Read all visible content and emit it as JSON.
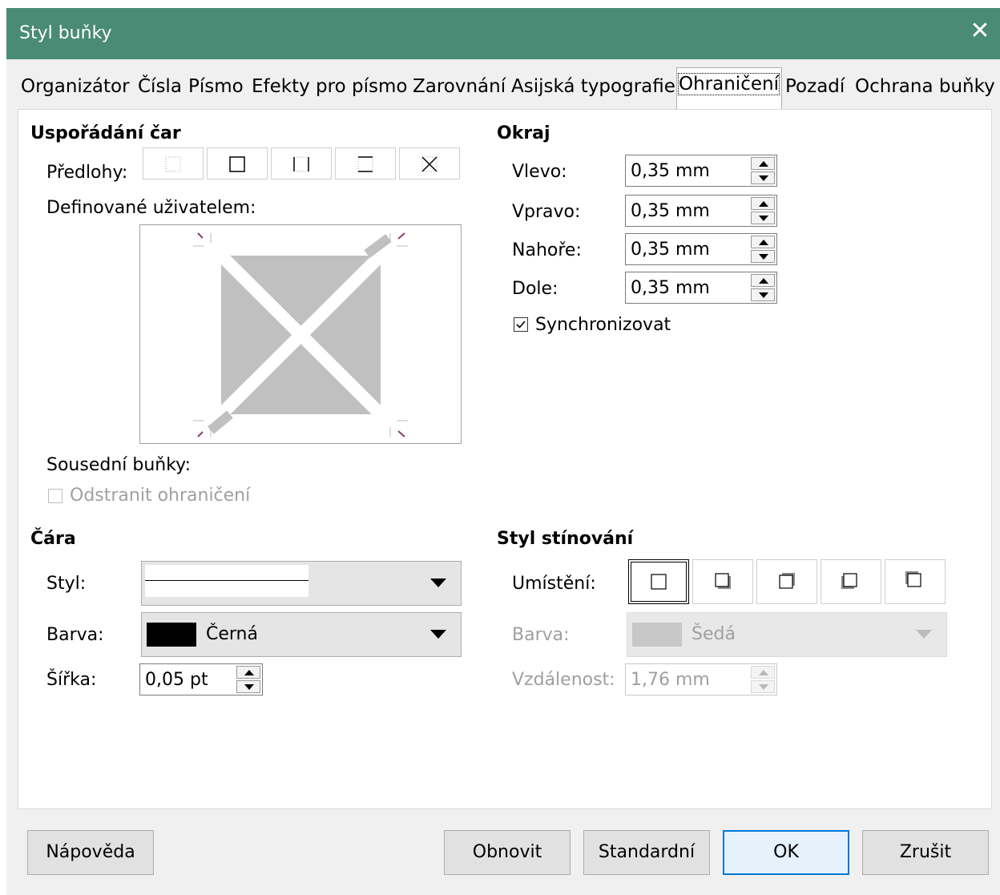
{
  "window": {
    "title": "Styl buňky"
  },
  "tabs": [
    {
      "label": "Organizátor"
    },
    {
      "label": "Čísla"
    },
    {
      "label": "Písmo"
    },
    {
      "label": "Efekty pro písmo"
    },
    {
      "label": "Zarovnání"
    },
    {
      "label": "Asijská typografie"
    },
    {
      "label": "Ohraničení"
    },
    {
      "label": "Pozadí"
    },
    {
      "label": "Ochrana buňky"
    }
  ],
  "active_tab": "Ohraničení",
  "line_arrangement": {
    "heading": "Uspořádání čar",
    "presets_label": "Předlohy:",
    "user_defined_label": "Definované uživatelem:",
    "adjacent_cells_label": "Sousední buňky:",
    "remove_border_label": "Odstranit ohraničení",
    "remove_border_checked": false,
    "remove_border_enabled": false
  },
  "padding": {
    "heading": "Okraj",
    "left_label": "Vlevo:",
    "left_value": "0,35 mm",
    "right_label": "Vpravo:",
    "right_value": "0,35 mm",
    "top_label": "Nahoře:",
    "top_value": "0,35 mm",
    "bottom_label": "Dole:",
    "bottom_value": "0,35 mm",
    "sync_label": "Synchronizovat",
    "sync_checked": true
  },
  "line": {
    "heading": "Čára",
    "style_label": "Styl:",
    "color_label": "Barva:",
    "color_value": "Černá",
    "color_swatch": "#000000",
    "width_label": "Šířka:",
    "width_value": "0,05 pt"
  },
  "shadow": {
    "heading": "Styl stínování",
    "position_label": "Umístění:",
    "color_label": "Barva:",
    "color_value": "Šedá",
    "color_swatch": "#c0c0c0",
    "distance_label": "Vzdálenost:",
    "distance_value": "1,76 mm"
  },
  "buttons": {
    "help": "Nápověda",
    "reset": "Obnovit",
    "standard": "Standardní",
    "ok": "OK",
    "cancel": "Zrušit"
  },
  "colors": {
    "titlebar": "#4a8b76",
    "focus": "#0078d7"
  }
}
